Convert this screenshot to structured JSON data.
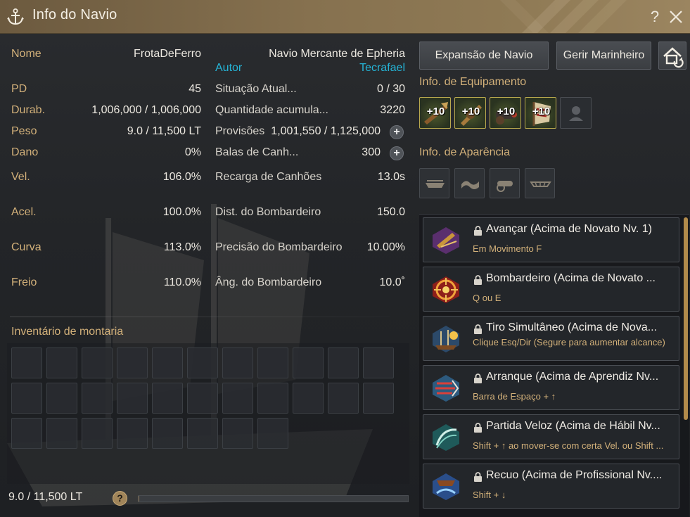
{
  "window": {
    "title": "Info do Navio",
    "help_label": "?",
    "accent_color": "#d3b17a",
    "link_color": "#25b4d6"
  },
  "icons": {
    "title": "anchor-icon",
    "close": "close-icon",
    "help": "question-icon",
    "swap": "ship-swap-icon"
  },
  "ship": {
    "name_label": "Nome",
    "name_value": "FrotaDeFerro",
    "type": "Navio Mercante de Epheria",
    "author_label": "Autor",
    "author_value": "Tecrafael"
  },
  "stats_left": [
    {
      "label": "PD",
      "value": "45"
    },
    {
      "label": "Durab.",
      "value": "1,006,000 / 1,006,000"
    },
    {
      "label": "Peso",
      "value": "9.0 / 11,500 LT"
    },
    {
      "label": "Dano",
      "value": "0%"
    },
    {
      "label": "Vel.",
      "value": "106.0%"
    },
    {
      "label": "Acel.",
      "value": "100.0%"
    },
    {
      "label": "Curva",
      "value": "113.0%"
    },
    {
      "label": "Freio",
      "value": "110.0%"
    }
  ],
  "stats_right": [
    {
      "label": "Situação Atual...",
      "value": "0 / 30"
    },
    {
      "label": "Quantidade acumula...",
      "value": "3220"
    },
    {
      "label": "Provisões",
      "value": "1,001,550 / 1,125,000"
    },
    {
      "label": "Balas de Canh...",
      "value": "300"
    },
    {
      "label": "Recarga de Canhões",
      "value": "13.0s"
    },
    {
      "label": "Dist. do Bombardeiro",
      "value": "150.0"
    },
    {
      "label": "Precisão do Bombardeiro",
      "value": "10.00%"
    },
    {
      "label": "Âng. do Bombardeiro",
      "value": "10.0˚"
    }
  ],
  "plus_label": "+",
  "inventory": {
    "title": "Inventário de montaria",
    "weight": "9.0 / 11,500 LT",
    "help_label": "?",
    "weight_fraction": 0.0008,
    "slot_count": 29
  },
  "buttons": {
    "expand": "Expansão de Navio",
    "sailors": "Gerir Marinheiro"
  },
  "equipment": {
    "title": "Info. de Equipamento",
    "items": [
      {
        "tag": "+10",
        "icon": "prow-icon"
      },
      {
        "tag": "+10",
        "icon": "plating-icon"
      },
      {
        "tag": "+10",
        "icon": "cannon-icon"
      },
      {
        "tag": "+10",
        "icon": "sail-icon"
      },
      {
        "tag": "",
        "icon": "sailor-icon"
      }
    ]
  },
  "appearance": {
    "title": "Info. de Aparência",
    "items": [
      "hull-icon",
      "flag-icon",
      "cannon-deco-icon",
      "ornament-icon"
    ]
  },
  "skills": [
    {
      "name": "Avançar (Acima de Novato Nv. 1)",
      "key": "Em Movimento F",
      "icon": "advance-skill-icon"
    },
    {
      "name": "Bombardeiro (Acima de Novato ...",
      "key": "Q ou E",
      "icon": "bombard-skill-icon"
    },
    {
      "name": "Tiro Simultâneo (Acima de Nova...",
      "key": "Clique Esq/Dir (Segure para aumentar alcance)",
      "icon": "volley-skill-icon"
    },
    {
      "name": "Arranque (Acima de Aprendiz Nv...",
      "key": "Barra de Espaço + ↑",
      "icon": "dash-skill-icon"
    },
    {
      "name": "Partida Veloz (Acima de Hábil Nv...",
      "key": "Shift + ↑ ao mover-se com certa Vel. ou Shift ...",
      "icon": "quickstart-skill-icon"
    },
    {
      "name": "Recuo (Acima de Profissional Nv....",
      "key": "Shift + ↓",
      "icon": "retreat-skill-icon"
    }
  ]
}
